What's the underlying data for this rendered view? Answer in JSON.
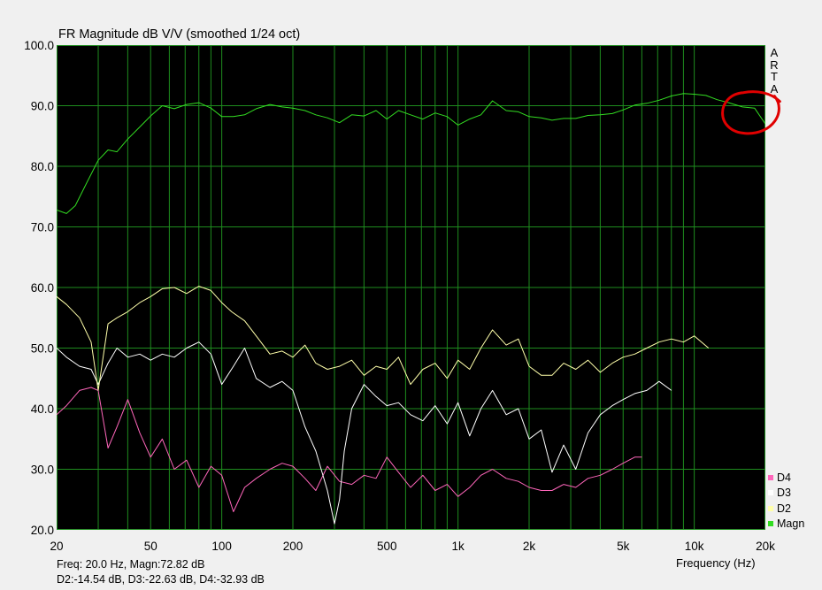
{
  "header": {
    "title": "FR Magnitude dB V/V (smoothed 1/24 oct)"
  },
  "brand": {
    "letters": [
      "A",
      "R",
      "T",
      "A"
    ]
  },
  "readout": {
    "line1": "Freq: 20.0 Hz, Magn:72.82 dB",
    "line2": "D2:-14.54 dB, D3:-22.63 dB, D4:-32.93 dB"
  },
  "colors": {
    "plot_background": "#000000",
    "grid": "#1e8c1e",
    "magn": "#33dd22",
    "d2": "#ffffaa",
    "d3": "#ffffff",
    "d4": "#ff66bb",
    "annotation": "#e00000"
  },
  "chart_data": {
    "type": "line",
    "title": "FR Magnitude dB V/V (smoothed 1/24 oct)",
    "xlabel": "Frequency (Hz)",
    "ylabel": "",
    "x_scale": "log",
    "xlim": [
      20,
      20000
    ],
    "ylim": [
      20,
      100
    ],
    "grid": true,
    "legend_placement": "right-bottom",
    "yticks": [
      "100.0",
      "90.0",
      "80.0",
      "70.0",
      "60.0",
      "50.0",
      "40.0",
      "30.0",
      "20.0"
    ],
    "xticks": [
      {
        "value": 20,
        "label": "20"
      },
      {
        "value": 50,
        "label": "50"
      },
      {
        "value": 100,
        "label": "100"
      },
      {
        "value": 200,
        "label": "200"
      },
      {
        "value": 500,
        "label": "500"
      },
      {
        "value": 1000,
        "label": "1k"
      },
      {
        "value": 2000,
        "label": "2k"
      },
      {
        "value": 5000,
        "label": "5k"
      },
      {
        "value": 10000,
        "label": "10k"
      },
      {
        "value": 20000,
        "label": "20k"
      }
    ],
    "legend": [
      "D4",
      "D3",
      "D2",
      "Magn"
    ],
    "annotation": "red hand-drawn circle around the Magn curve between about 15 kHz and 20 kHz",
    "series": [
      {
        "name": "Magn",
        "x": [
          20,
          22,
          24,
          27,
          30,
          33,
          36,
          40,
          45,
          50,
          56,
          63,
          71,
          80,
          90,
          100,
          112,
          125,
          140,
          160,
          180,
          200,
          225,
          250,
          280,
          315,
          355,
          400,
          450,
          500,
          560,
          630,
          710,
          800,
          900,
          1000,
          1120,
          1250,
          1400,
          1600,
          1800,
          2000,
          2250,
          2500,
          2800,
          3150,
          3550,
          4000,
          4500,
          5000,
          5600,
          6300,
          7100,
          8000,
          9000,
          10000,
          11200,
          12500,
          14000,
          16000,
          18000,
          20000
        ],
        "y": [
          72.8,
          72.2,
          73.5,
          77.5,
          81.0,
          82.7,
          82.4,
          84.5,
          86.5,
          88.3,
          90.0,
          89.5,
          90.2,
          90.5,
          89.6,
          88.2,
          88.2,
          88.5,
          89.5,
          90.2,
          89.8,
          89.6,
          89.2,
          88.5,
          88.0,
          87.2,
          88.5,
          88.3,
          89.2,
          87.8,
          89.2,
          88.5,
          87.8,
          88.8,
          88.2,
          86.8,
          87.8,
          88.5,
          90.8,
          89.2,
          89.0,
          88.2,
          88.0,
          87.6,
          87.9,
          87.9,
          88.4,
          88.5,
          88.7,
          89.3,
          90.1,
          90.4,
          90.9,
          91.6,
          92.0,
          91.9,
          91.7,
          91.0,
          90.5,
          89.8,
          89.6,
          87.0
        ]
      },
      {
        "name": "D2",
        "x": [
          20,
          22,
          25,
          28,
          30,
          33,
          36,
          40,
          45,
          50,
          56,
          63,
          71,
          80,
          90,
          100,
          110,
          125,
          140,
          160,
          180,
          200,
          225,
          250,
          280,
          315,
          355,
          400,
          450,
          500,
          560,
          630,
          710,
          800,
          900,
          1000,
          1120,
          1250,
          1400,
          1600,
          1800,
          2000,
          2250,
          2500,
          2800,
          3150,
          3550,
          4000,
          4500,
          5000,
          5600,
          6300,
          7100,
          8000,
          9000,
          10000,
          11500
        ],
        "y": [
          58.5,
          57.2,
          55.0,
          51.0,
          43.0,
          54.0,
          55.0,
          56.0,
          57.5,
          58.5,
          59.8,
          60.0,
          59.0,
          60.2,
          59.5,
          57.5,
          56.0,
          54.5,
          52.0,
          49.0,
          49.5,
          48.5,
          50.5,
          47.5,
          46.5,
          47.0,
          48.0,
          45.5,
          47.0,
          46.5,
          48.5,
          44.0,
          46.5,
          47.5,
          45.0,
          48.0,
          46.5,
          50.0,
          53.0,
          50.5,
          51.5,
          47.0,
          45.5,
          45.5,
          47.5,
          46.5,
          48.0,
          46.0,
          47.5,
          48.5,
          49.0,
          50.0,
          51.0,
          51.5,
          51.0,
          52.0,
          50.0
        ]
      },
      {
        "name": "D3",
        "x": [
          20,
          22,
          25,
          28,
          30,
          33,
          36,
          40,
          45,
          50,
          56,
          63,
          71,
          80,
          90,
          100,
          112,
          125,
          140,
          160,
          180,
          200,
          225,
          250,
          280,
          300,
          315,
          330,
          355,
          400,
          450,
          500,
          560,
          630,
          710,
          800,
          900,
          1000,
          1120,
          1250,
          1400,
          1600,
          1800,
          2000,
          2250,
          2500,
          2800,
          3150,
          3550,
          4000,
          4500,
          5000,
          5600,
          6300,
          7100,
          8000
        ],
        "y": [
          50.0,
          48.5,
          47.0,
          46.5,
          44.0,
          47.5,
          50.0,
          48.5,
          49.0,
          48.0,
          49.0,
          48.5,
          50.0,
          51.0,
          49.0,
          44.0,
          47.0,
          50.0,
          45.0,
          43.5,
          44.5,
          43.0,
          37.0,
          33.0,
          26.5,
          21.0,
          25.0,
          33.0,
          40.0,
          44.0,
          42.0,
          40.5,
          41.0,
          39.0,
          38.0,
          40.5,
          37.5,
          41.0,
          35.5,
          40.0,
          43.0,
          39.0,
          40.0,
          35.0,
          36.5,
          29.5,
          34.0,
          30.0,
          36.0,
          39.0,
          40.5,
          41.5,
          42.5,
          43.0,
          44.5,
          43.0
        ]
      },
      {
        "name": "D4",
        "x": [
          20,
          22,
          25,
          28,
          30,
          33,
          36,
          40,
          45,
          50,
          56,
          63,
          71,
          80,
          90,
          100,
          112,
          125,
          140,
          160,
          180,
          200,
          225,
          250,
          280,
          315,
          355,
          400,
          450,
          500,
          560,
          630,
          710,
          800,
          900,
          1000,
          1120,
          1250,
          1400,
          1600,
          1800,
          2000,
          2250,
          2500,
          2800,
          3150,
          3550,
          4000,
          4500,
          5000,
          5600,
          6000
        ],
        "y": [
          39.0,
          40.5,
          43.0,
          43.5,
          43.0,
          33.5,
          37.0,
          41.5,
          36.0,
          32.0,
          35.0,
          30.0,
          31.5,
          27.0,
          30.5,
          29.0,
          23.0,
          27.0,
          28.5,
          30.0,
          31.0,
          30.5,
          28.5,
          26.5,
          30.5,
          28.0,
          27.5,
          29.0,
          28.5,
          32.0,
          29.5,
          27.0,
          29.0,
          26.5,
          27.5,
          25.5,
          27.0,
          29.0,
          30.0,
          28.5,
          28.0,
          27.0,
          26.5,
          26.5,
          27.5,
          27.0,
          28.5,
          29.0,
          30.0,
          31.0,
          32.0,
          32.0
        ]
      }
    ]
  }
}
